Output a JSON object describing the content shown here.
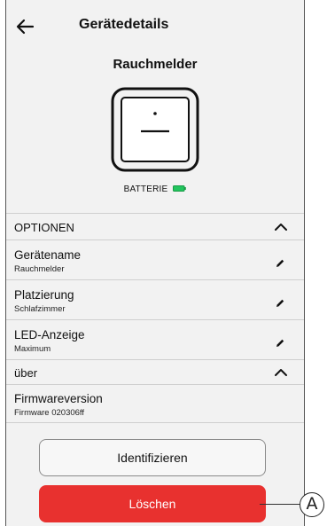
{
  "header": {
    "title": "Gerätedetails",
    "back_icon": "arrow-left-icon"
  },
  "device": {
    "name": "Rauchmelder",
    "icon": "smoke-detector-icon",
    "battery_label": "BATTERIE",
    "battery_icon": "battery-full-icon",
    "battery_color": "#22c55e"
  },
  "options": {
    "section_label": "OPTIONEN",
    "items": [
      {
        "label": "Gerätename",
        "value": "Rauchmelder",
        "icon": "pencil-icon"
      },
      {
        "label": "Platzierung",
        "value": "Schlafzimmer",
        "icon": "pencil-icon"
      },
      {
        "label": "LED-Anzeige",
        "value": "Maximum",
        "icon": "pencil-icon"
      }
    ]
  },
  "about": {
    "section_label": "über",
    "items": [
      {
        "label": "Firmwareversion",
        "value": "Firmware 020306ff"
      }
    ]
  },
  "actions": {
    "identify_label": "Identifizieren",
    "delete_label": "Löschen",
    "delete_color": "#e8312f"
  },
  "callout": {
    "label": "A"
  }
}
